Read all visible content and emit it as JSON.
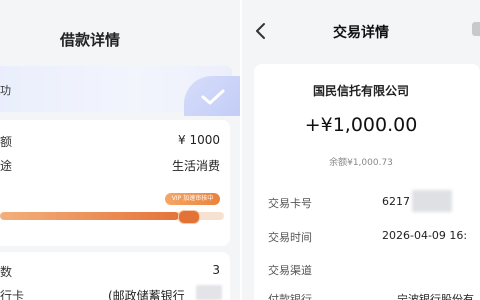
{
  "left_panel": {
    "title": "借款详情",
    "hero_text": "功",
    "rows": [
      {
        "label": "额",
        "value": "¥ 1000"
      },
      {
        "label": "途",
        "value": "生活消费"
      }
    ],
    "progress_tag": "VIP 加速审核中",
    "progress_fraction": 0.8,
    "rows2": [
      {
        "label": "数",
        "value": "3"
      },
      {
        "label": "行卡",
        "value": "(邮政储蓄银行"
      }
    ]
  },
  "right_panel": {
    "title": "交易详情",
    "payee": "国民信托有限公司",
    "amount": "+¥1,000.00",
    "balance": "余额¥1,000.73",
    "rows": [
      {
        "label": "交易卡号",
        "value": "6217"
      },
      {
        "label": "交易时间",
        "value": "2026-04-09 16:"
      },
      {
        "label": "交易渠道",
        "value": ""
      },
      {
        "label": "付款银行",
        "value": "宁波银行股份有"
      }
    ]
  },
  "colors": {
    "accent_orange": "#e4743a",
    "hero_blue": "#c3cdf6",
    "background": "#f4f5f7"
  }
}
